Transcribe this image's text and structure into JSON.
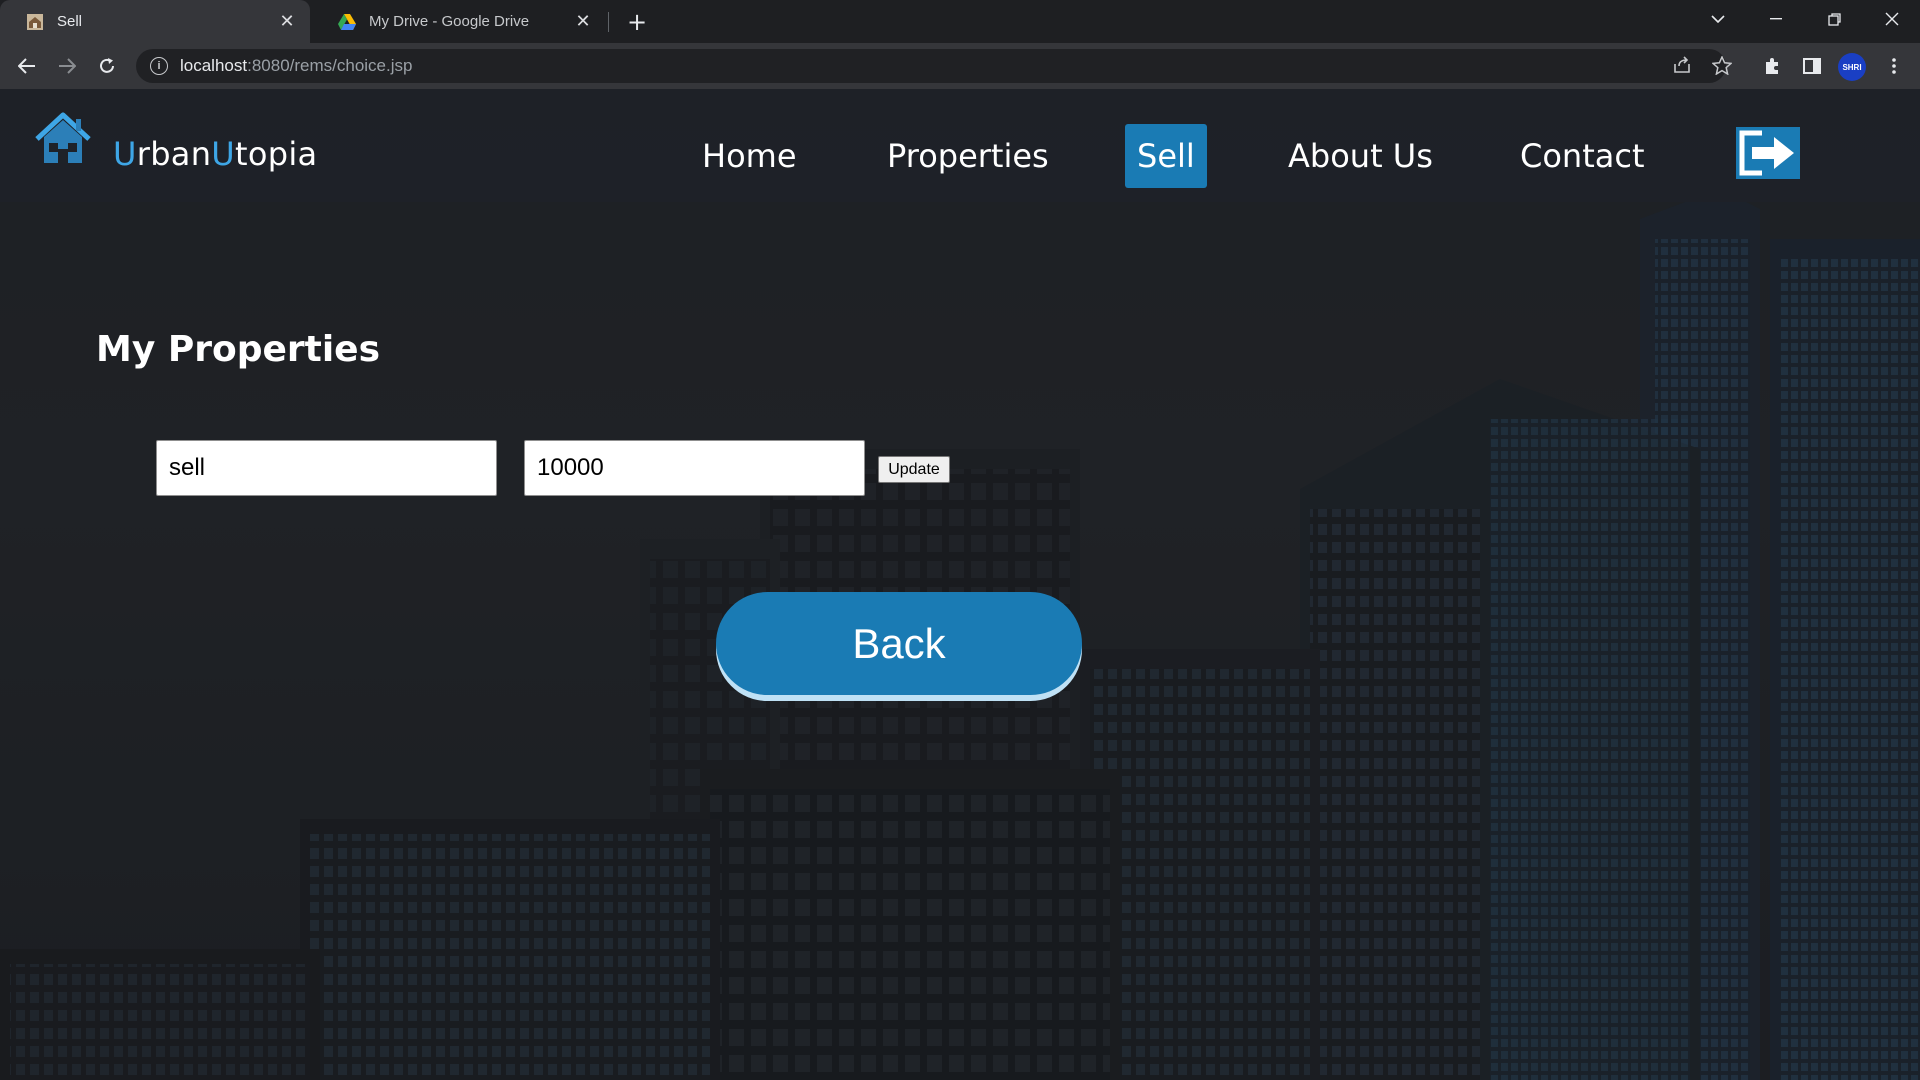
{
  "browser": {
    "tabs": [
      {
        "title": "Sell",
        "active": true,
        "favicon": "site-favicon"
      },
      {
        "title": "My Drive - Google Drive",
        "active": false,
        "favicon": "google-drive-icon"
      }
    ],
    "url_host": "localhost",
    "url_path": ":8080/rems/choice.jsp",
    "profile_label": "SHRI"
  },
  "site": {
    "brand_first_initial": "U",
    "brand_first_rest": "rban",
    "brand_second_initial": "U",
    "brand_second_rest": "topia",
    "accent_color": "#3ea6e6",
    "active_nav_color": "#1a7bb4"
  },
  "nav": {
    "items": [
      {
        "label": "Home",
        "active": false
      },
      {
        "label": "Properties",
        "active": false
      },
      {
        "label": "Sell",
        "active": true
      },
      {
        "label": "About Us",
        "active": false
      },
      {
        "label": "Contact",
        "active": false
      }
    ]
  },
  "main": {
    "title": "My Properties",
    "form": {
      "type_value": "sell",
      "price_value": "10000",
      "update_label": "Update"
    },
    "back_label": "Back"
  }
}
